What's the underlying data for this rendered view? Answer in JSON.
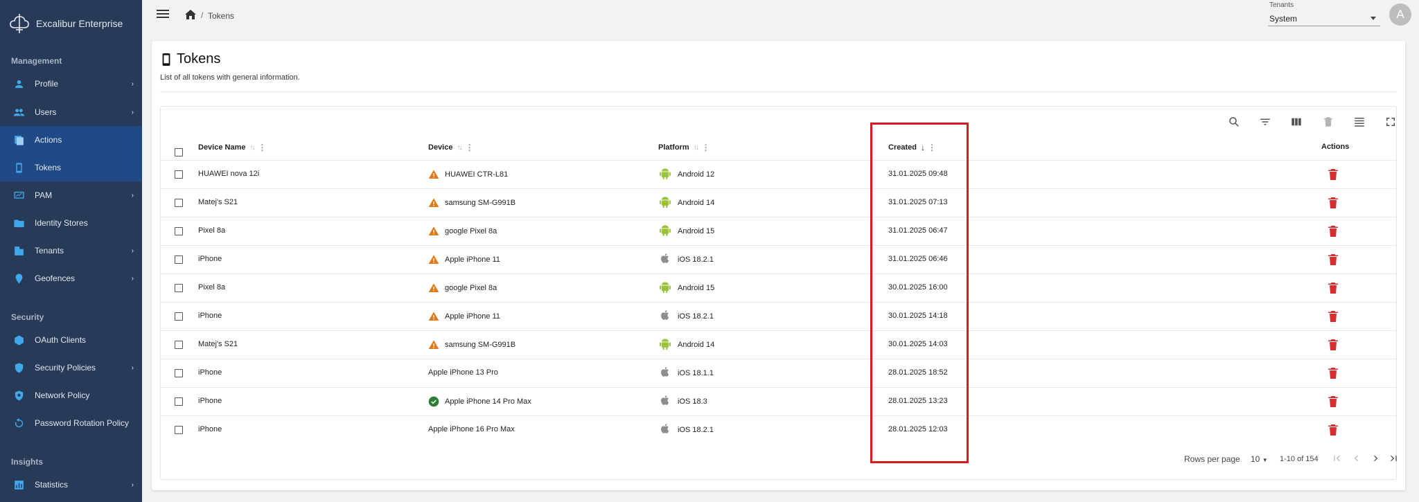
{
  "app": {
    "name": "Excalibur Enterprise"
  },
  "sidebar": {
    "sections": [
      {
        "label": "Management"
      },
      {
        "label": "Security"
      },
      {
        "label": "Insights"
      }
    ],
    "items": [
      {
        "label": "Profile",
        "icon": "person-icon",
        "has_children": true
      },
      {
        "label": "Users",
        "icon": "people-icon",
        "has_children": true
      },
      {
        "label": "Actions",
        "icon": "actions-icon",
        "has_children": false
      },
      {
        "label": "Tokens",
        "icon": "phone-icon",
        "has_children": false
      },
      {
        "label": "PAM",
        "icon": "pam-icon",
        "has_children": true
      },
      {
        "label": "Identity Stores",
        "icon": "folder-icon",
        "has_children": false
      },
      {
        "label": "Tenants",
        "icon": "building-icon",
        "has_children": true
      },
      {
        "label": "Geofences",
        "icon": "location-icon",
        "has_children": true
      },
      {
        "label": "OAuth Clients",
        "icon": "cube-icon",
        "has_children": false
      },
      {
        "label": "Security Policies",
        "icon": "shield-icon",
        "has_children": true
      },
      {
        "label": "Network Policy",
        "icon": "network-icon",
        "has_children": false
      },
      {
        "label": "Password Rotation Policy",
        "icon": "rotation-icon",
        "has_children": false
      },
      {
        "label": "Statistics",
        "icon": "chart-icon",
        "has_children": true
      }
    ],
    "active": "Tokens",
    "chevron": "›"
  },
  "topbar": {
    "breadcrumb_sep": "/",
    "breadcrumb_current": "Tokens",
    "tenant_label": "Tenants",
    "tenant_value": "System",
    "avatar_letter": "A"
  },
  "page": {
    "title": "Tokens",
    "subtitle": "List of all tokens with general information."
  },
  "table": {
    "columns": [
      {
        "label": "Device Name",
        "sorted": false
      },
      {
        "label": "Device",
        "sorted": false
      },
      {
        "label": "Platform",
        "sorted": false
      },
      {
        "label": "Created",
        "sorted": true
      },
      {
        "label": "Actions",
        "sorted": false
      }
    ],
    "rows": [
      {
        "device_name": "HUAWEI nova 12i",
        "device": "HUAWEI CTR-L81",
        "device_status": "warning",
        "platform": "Android 12",
        "platform_icon": "android",
        "created": "31.01.2025 09:48"
      },
      {
        "device_name": "Matej's S21",
        "device": "samsung SM-G991B",
        "device_status": "warning",
        "platform": "Android 14",
        "platform_icon": "android",
        "created": "31.01.2025 07:13"
      },
      {
        "device_name": "Pixel 8a",
        "device": "google Pixel 8a",
        "device_status": "warning",
        "platform": "Android 15",
        "platform_icon": "android",
        "created": "31.01.2025 06:47"
      },
      {
        "device_name": "iPhone",
        "device": "Apple iPhone 11",
        "device_status": "warning",
        "platform": "iOS 18.2.1",
        "platform_icon": "apple",
        "created": "31.01.2025 06:46"
      },
      {
        "device_name": "Pixel 8a",
        "device": "google Pixel 8a",
        "device_status": "warning",
        "platform": "Android 15",
        "platform_icon": "android",
        "created": "30.01.2025 16:00"
      },
      {
        "device_name": "iPhone",
        "device": "Apple iPhone 11",
        "device_status": "warning",
        "platform": "iOS 18.2.1",
        "platform_icon": "apple",
        "created": "30.01.2025 14:18"
      },
      {
        "device_name": "Matej's S21",
        "device": "samsung SM-G991B",
        "device_status": "warning",
        "platform": "Android 14",
        "platform_icon": "android",
        "created": "30.01.2025 14:03"
      },
      {
        "device_name": "iPhone",
        "device": "Apple iPhone 13 Pro",
        "device_status": "none",
        "platform": "iOS 18.1.1",
        "platform_icon": "apple",
        "created": "28.01.2025 18:52"
      },
      {
        "device_name": "iPhone",
        "device": "Apple iPhone 14 Pro Max",
        "device_status": "ok",
        "platform": "iOS 18.3",
        "platform_icon": "apple",
        "created": "28.01.2025 13:23"
      },
      {
        "device_name": "iPhone",
        "device": "Apple iPhone 16 Pro Max",
        "device_status": "none",
        "platform": "iOS 18.2.1",
        "platform_icon": "apple",
        "created": "28.01.2025 12:03"
      }
    ]
  },
  "pagination": {
    "rows_per_page_label": "Rows per page",
    "rows_per_page": "10",
    "range": "1-10 of 154"
  },
  "colors": {
    "sidebar_bg": "#273a57",
    "sidebar_active": "#1f4a85",
    "icon_blue": "#3fa7ea",
    "warning": "#e07a18",
    "ok": "#2e7d32",
    "android": "#9bc13b",
    "apple": "#8e8e8e",
    "delete": "#d32f2f",
    "highlight": "#d8191f"
  }
}
